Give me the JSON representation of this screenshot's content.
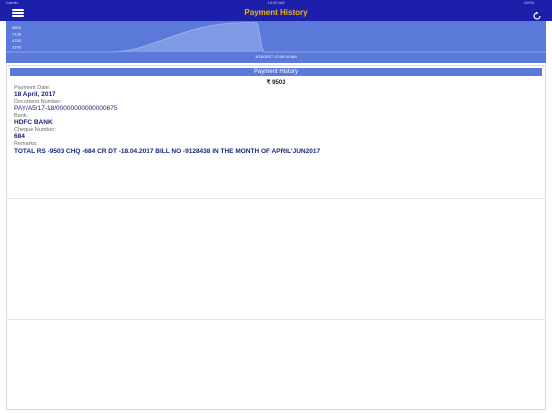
{
  "status_bar": {
    "carrier": "Carrier",
    "time": "10:49 AM",
    "battery": "100%"
  },
  "nav": {
    "title": "Payment History",
    "menu_icon": "hamburger-menu-icon",
    "refresh_icon": "refresh-icon"
  },
  "chart": {
    "ticks": [
      "9504",
      "7128",
      "4752",
      "2376"
    ],
    "date_label": "4/18/2017 12:00:00 AM"
  },
  "chart_data": {
    "type": "area",
    "x": [
      "4/18/2017 12:00:00 AM"
    ],
    "y_ticks": [
      9504,
      7128,
      4752,
      2376
    ],
    "values": [
      9503
    ],
    "grid": false,
    "legend": "none",
    "fill_color": "#7f9be5",
    "line_color": "#9fb3ee"
  },
  "panel": {
    "header": "Payment History",
    "amount": "₹ 9503",
    "fields": [
      {
        "label": "Payment Date:",
        "value": "18 April, 2017"
      },
      {
        "label": "Document Number:",
        "value": "PAY/A5/17-18/00000000000000675"
      },
      {
        "label": "Bank:",
        "value": "HDFC BANK"
      },
      {
        "label": "Cheque Number:",
        "value": "684"
      },
      {
        "label": "Remarks:",
        "value": "TOTAL RS -9503 CHQ -684 CR DT -18.04.2017 BILL NO -9128438 IN THE MONTH OF APRIL'JUN2017"
      }
    ]
  },
  "colors": {
    "nav_bg": "#1c1faa",
    "title": "#f2b300",
    "accent": "#5b79d8",
    "value_text": "#1a237e"
  }
}
